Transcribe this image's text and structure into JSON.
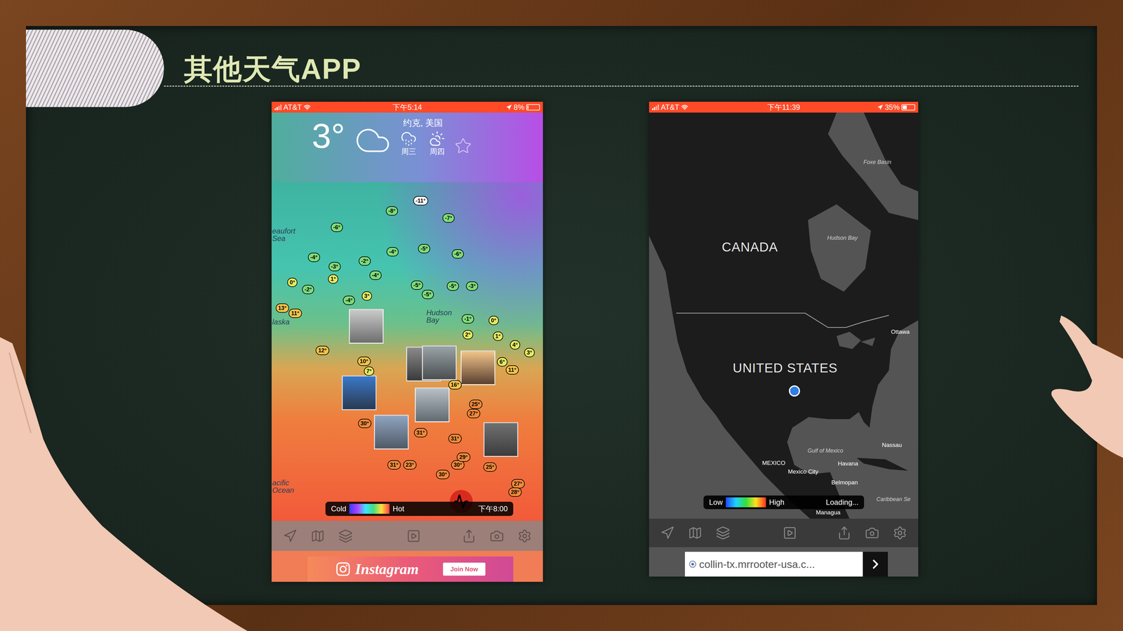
{
  "slide": {
    "title": "其他天气APP"
  },
  "weather_app": {
    "status_bar": {
      "carrier": "AT&T",
      "time": "下午5:14",
      "battery": "8%",
      "battery_level": 0.08
    },
    "header": {
      "temperature": "3°",
      "location": "约克, 美国",
      "forecast": [
        {
          "day": "周三"
        },
        {
          "day": "周四"
        }
      ],
      "favorite": false
    },
    "map_labels": [
      "eaufort Sea",
      "laska",
      "Hudson Bay",
      "acific Ocean"
    ],
    "stations": [
      {
        "temp": "-11°",
        "color": "#ffffff"
      },
      {
        "temp": "-8°",
        "color": "#7fdc7a"
      },
      {
        "temp": "-7°",
        "color": "#7fdc7a"
      },
      {
        "temp": "-6°",
        "color": "#7fdc7a"
      },
      {
        "temp": "-4°",
        "color": "#7fdc7a"
      },
      {
        "temp": "-2°",
        "color": "#7fdc7a"
      },
      {
        "temp": "-4°",
        "color": "#7fdc7a"
      },
      {
        "temp": "-5°",
        "color": "#7fdc7a"
      },
      {
        "temp": "-6°",
        "color": "#7fdc7a"
      },
      {
        "temp": "-3°",
        "color": "#7fdc7a"
      },
      {
        "temp": "-4°",
        "color": "#7fdc7a"
      },
      {
        "temp": "1°",
        "color": "#e4ea62"
      },
      {
        "temp": "0°",
        "color": "#e4ea62"
      },
      {
        "temp": "-2°",
        "color": "#7fdc7a"
      },
      {
        "temp": "-5°",
        "color": "#7fdc7a"
      },
      {
        "temp": "-5°",
        "color": "#7fdc7a"
      },
      {
        "temp": "-3°",
        "color": "#7fdc7a"
      },
      {
        "temp": "-4°",
        "color": "#7fdc7a"
      },
      {
        "temp": "3°",
        "color": "#e4ea62"
      },
      {
        "temp": "-5°",
        "color": "#7fdc7a"
      },
      {
        "temp": "13°",
        "color": "#f6c44a"
      },
      {
        "temp": "11°",
        "color": "#f6c44a"
      },
      {
        "temp": "-1°",
        "color": "#7fdc7a"
      },
      {
        "temp": "0°",
        "color": "#e4ea62"
      },
      {
        "temp": "2°",
        "color": "#e4ea62"
      },
      {
        "temp": "1°",
        "color": "#e4ea62"
      },
      {
        "temp": "4°",
        "color": "#e4ea62"
      },
      {
        "temp": "12°",
        "color": "#f6c44a"
      },
      {
        "temp": "3°",
        "color": "#e4ea62"
      },
      {
        "temp": "10°",
        "color": "#f6c44a"
      },
      {
        "temp": "6°",
        "color": "#e4ea62"
      },
      {
        "temp": "11°",
        "color": "#f6c44a"
      },
      {
        "temp": "7°",
        "color": "#e4ea62"
      },
      {
        "temp": "16°",
        "color": "#f6c44a"
      },
      {
        "temp": "25°",
        "color": "#f28a3c"
      },
      {
        "temp": "27°",
        "color": "#f28a3c"
      },
      {
        "temp": "31°",
        "color": "#f28a3c"
      },
      {
        "temp": "31°",
        "color": "#f28a3c"
      },
      {
        "temp": "30°",
        "color": "#f28a3c"
      },
      {
        "temp": "31°",
        "color": "#f28a3c"
      },
      {
        "temp": "23°",
        "color": "#f28a3c"
      },
      {
        "temp": "25°",
        "color": "#f28a3c"
      },
      {
        "temp": "30°",
        "color": "#f28a3c"
      },
      {
        "temp": "27°",
        "color": "#f28a3c"
      },
      {
        "temp": "28°",
        "color": "#f28a3c"
      },
      {
        "temp": "30°",
        "color": "#f28a3c"
      },
      {
        "temp": "29°",
        "color": "#f28a3c"
      }
    ],
    "legend": {
      "low": "Cold",
      "high": "Hot",
      "time": "下午8:00"
    },
    "ad": {
      "brand": "Instagram",
      "button": "Join Now"
    }
  },
  "radar_app": {
    "status_bar": {
      "carrier": "AT&T",
      "time": "下午11:39",
      "battery": "35%",
      "battery_level": 0.35
    },
    "map_labels": [
      {
        "text": "CANADA",
        "kind": "country"
      },
      {
        "text": "UNITED STATES",
        "kind": "country"
      },
      {
        "text": "Hudson Bay",
        "kind": "water"
      },
      {
        "text": "Foxe Basin",
        "kind": "water"
      },
      {
        "text": "Ottawa",
        "kind": "city"
      },
      {
        "text": "Gulf of Mexico",
        "kind": "water"
      },
      {
        "text": "MEXICO",
        "kind": "city"
      },
      {
        "text": "Mexico City",
        "kind": "city"
      },
      {
        "text": "Havana",
        "kind": "city"
      },
      {
        "text": "Nassau",
        "kind": "city"
      },
      {
        "text": "Belmopan",
        "kind": "city"
      },
      {
        "text": "Caribbean Se",
        "kind": "water"
      },
      {
        "text": "Managua",
        "kind": "city"
      }
    ],
    "legend": {
      "low": "Low",
      "high": "High",
      "status": "Loading..."
    },
    "ad": {
      "url": "collin-tx.mrrooter-usa.c..."
    }
  }
}
